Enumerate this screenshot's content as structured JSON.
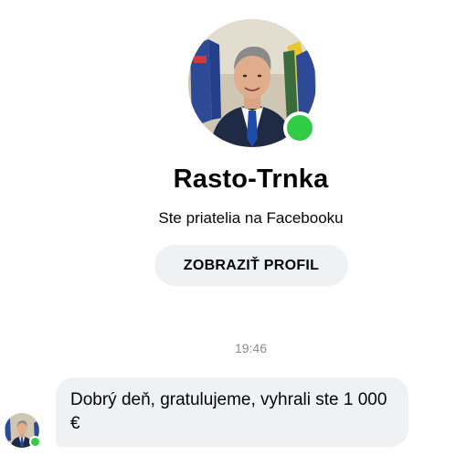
{
  "profile": {
    "name": "Rasto-Trnka",
    "friend_status": "Ste priatelia na Facebooku",
    "view_profile_label": "ZOBRAZIŤ PROFIL",
    "online": true
  },
  "conversation": {
    "timestamp": "19:46",
    "messages": [
      {
        "sender": "Rasto-Trnka",
        "text": "Dobrý deň, gratulujeme, vyhrali ste 1 000 €"
      }
    ]
  },
  "colors": {
    "online_indicator": "#31cc46",
    "bubble_background": "#f0f1f3",
    "button_background": "#f0f1f3",
    "timestamp_text": "#8a8d91"
  },
  "icons": {
    "profile_photo": "person-avatar",
    "presence": "online-dot"
  }
}
